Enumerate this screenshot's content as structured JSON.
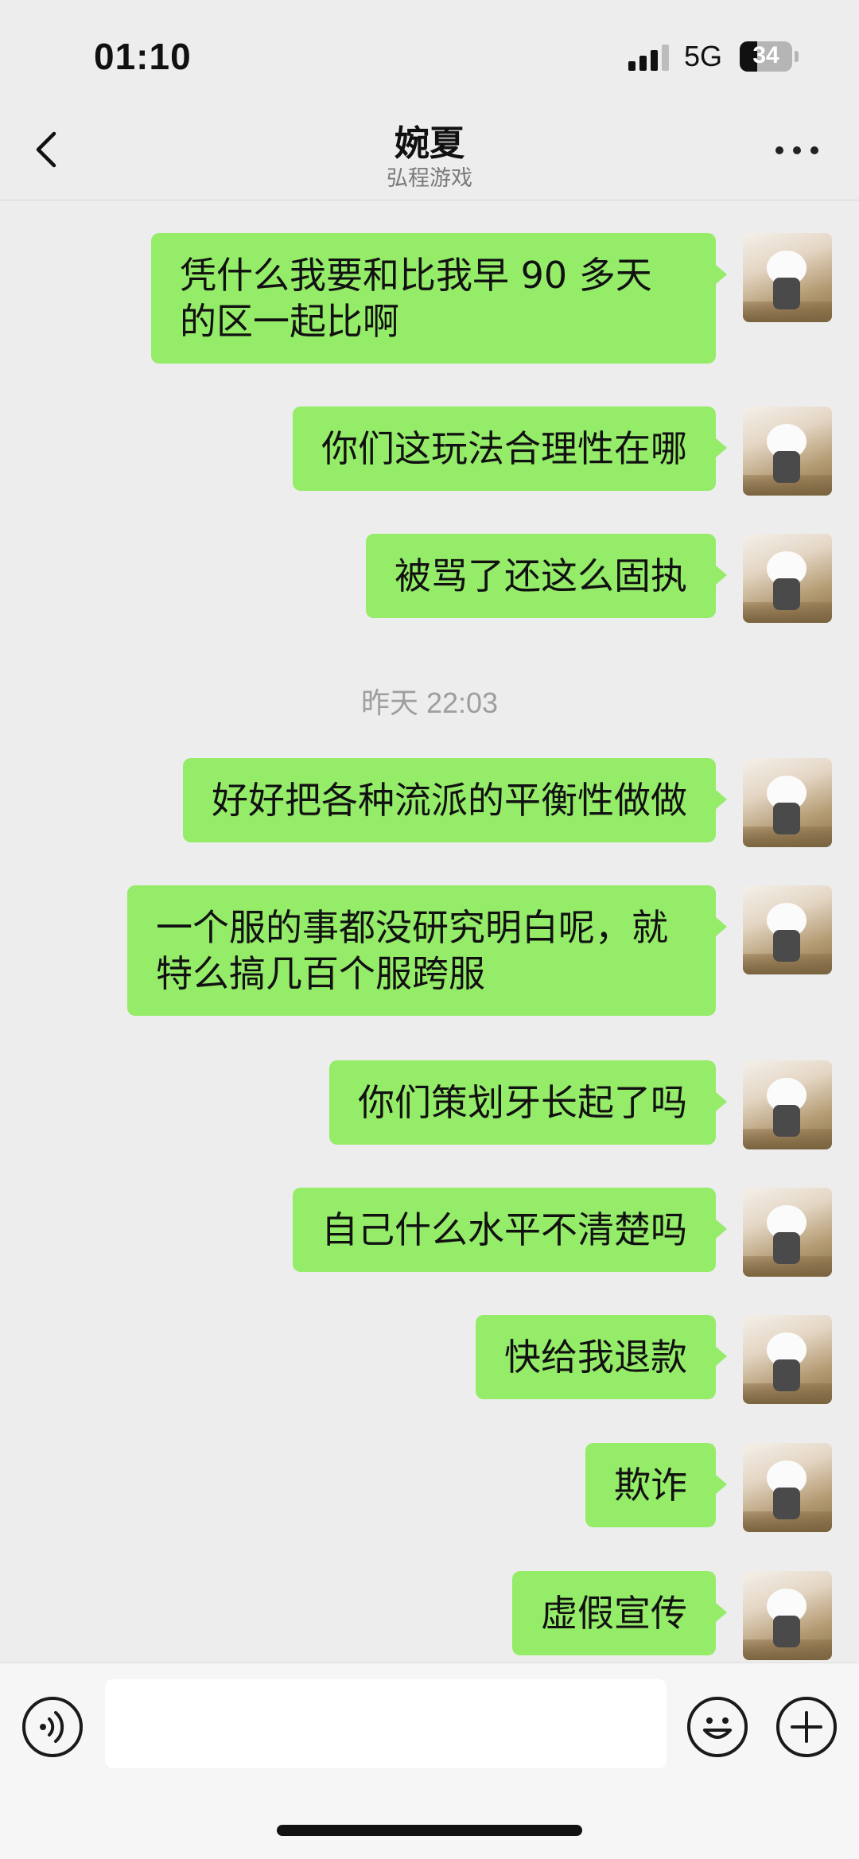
{
  "status_bar": {
    "time": "01:10",
    "network": "5G",
    "battery_percent": "34",
    "battery_level": 0.34,
    "signal_bars": 3
  },
  "header": {
    "title": "婉夏",
    "subtitle": "弘程游戏",
    "back_icon": "chevron-left-icon",
    "more_icon": "ellipsis-icon"
  },
  "messages": [
    {
      "text": "凭什么我要和比我早 90 多天的区一起比啊",
      "sender": "me"
    },
    {
      "text": "你们这玩法合理性在哪",
      "sender": "me"
    },
    {
      "text": "被骂了还这么固执",
      "sender": "me"
    },
    {
      "text": "好好把各种流派的平衡性做做",
      "sender": "me"
    },
    {
      "text": "一个服的事都没研究明白呢，就特么搞几百个服跨服",
      "sender": "me"
    },
    {
      "text": "你们策划牙长起了吗",
      "sender": "me"
    },
    {
      "text": "自己什么水平不清楚吗",
      "sender": "me"
    },
    {
      "text": "快给我退款",
      "sender": "me"
    },
    {
      "text": "欺诈",
      "sender": "me"
    },
    {
      "text": "虚假宣传",
      "sender": "me"
    }
  ],
  "timestamp": "昨天 22:03",
  "input_bar": {
    "voice_icon": "voice-icon",
    "emoji_icon": "emoji-icon",
    "plus_icon": "plus-icon",
    "input_value": ""
  },
  "colors": {
    "bubble": "#95ec69",
    "background": "#ededed"
  }
}
